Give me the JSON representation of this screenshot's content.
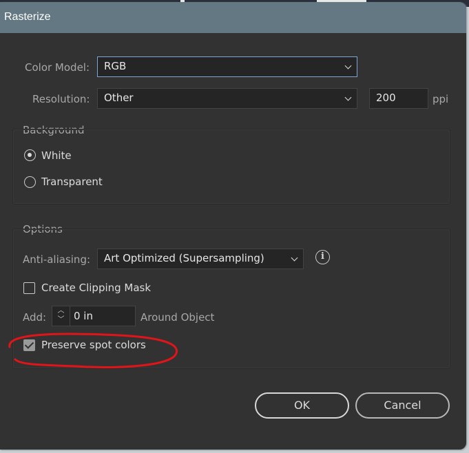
{
  "dialog": {
    "title": "Rasterize"
  },
  "color_model": {
    "label": "Color Model:",
    "value": "RGB"
  },
  "resolution": {
    "label": "Resolution:",
    "value": "Other",
    "ppi_value": "200",
    "ppi_unit": "ppi"
  },
  "background": {
    "title": "Background",
    "options": [
      {
        "label": "White",
        "selected": true
      },
      {
        "label": "Transparent",
        "selected": false
      }
    ]
  },
  "options": {
    "title": "Options",
    "anti_aliasing_label": "Anti-aliasing:",
    "anti_aliasing_value": "Art Optimized (Supersampling)",
    "clipping_mask": {
      "label": "Create Clipping Mask",
      "checked": false
    },
    "add_label": "Add:",
    "add_value": "0 in",
    "around_label": "Around Object",
    "preserve_spot": {
      "label": "Preserve spot colors",
      "checked": true
    }
  },
  "buttons": {
    "ok": "OK",
    "cancel": "Cancel"
  },
  "annotation_color": "#e0151a"
}
